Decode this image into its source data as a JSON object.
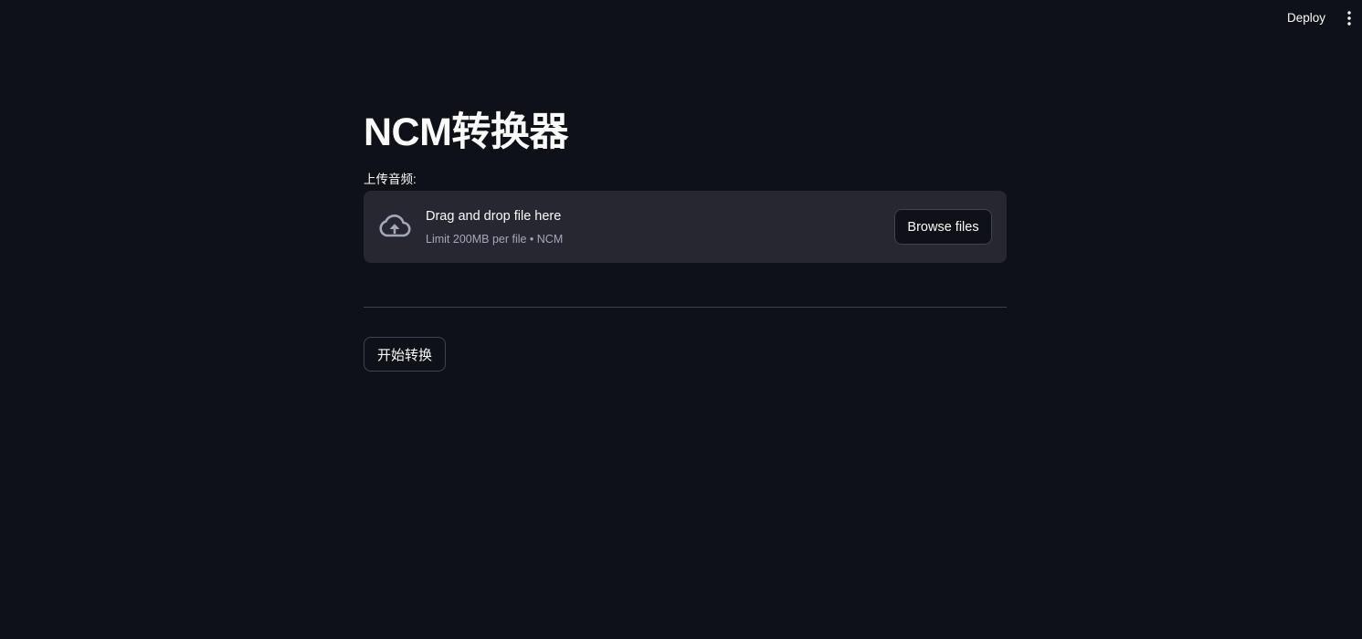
{
  "header": {
    "deploy_label": "Deploy",
    "menu_icon": "kebab-menu-icon"
  },
  "main": {
    "title": "NCM转换器",
    "uploader": {
      "label": "上传音频:",
      "icon": "cloud-upload-icon",
      "drop_text": "Drag and drop file here",
      "limit_text": "Limit 200MB per file • NCM",
      "browse_label": "Browse files"
    },
    "convert_label": "开始转换"
  },
  "colors": {
    "background": "#0e1117",
    "dropzone": "#262730",
    "text": "#fafafa",
    "muted_text": "#a3a8b8",
    "border": "#41444d"
  }
}
